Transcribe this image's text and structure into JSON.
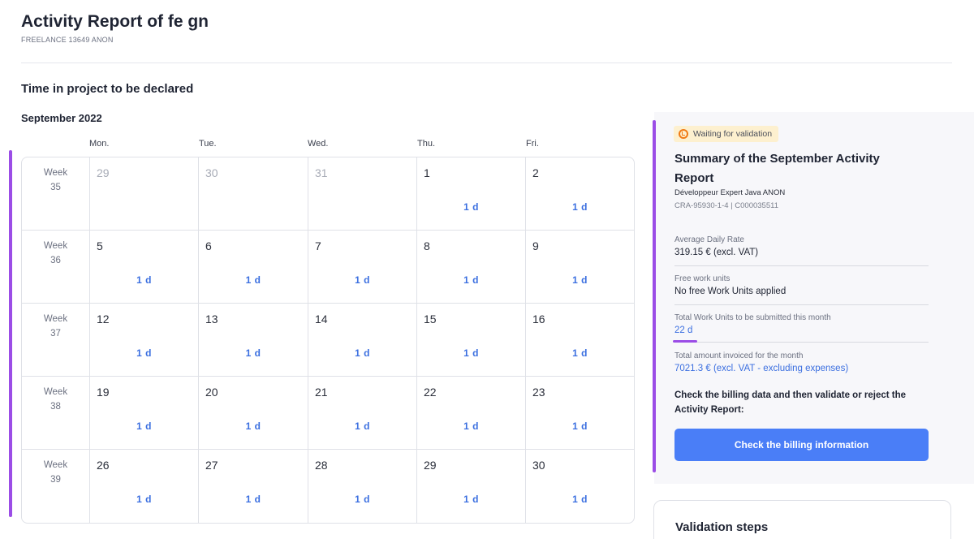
{
  "header": {
    "title": "Activity Report of fe gn",
    "subtitle": "FREELANCE 13649 ANON"
  },
  "section_title": "Time in project to be declared",
  "month_label": "September 2022",
  "calendar": {
    "days": [
      "Mon.",
      "Tue.",
      "Wed.",
      "Thu.",
      "Fri."
    ],
    "weeks": [
      {
        "label": "Week\n35",
        "cells": [
          {
            "day": "29",
            "muted": true,
            "value": ""
          },
          {
            "day": "30",
            "muted": true,
            "value": ""
          },
          {
            "day": "31",
            "muted": true,
            "value": ""
          },
          {
            "day": "1",
            "value": "1 d"
          },
          {
            "day": "2",
            "value": "1 d"
          }
        ]
      },
      {
        "label": "Week\n36",
        "cells": [
          {
            "day": "5",
            "value": "1 d"
          },
          {
            "day": "6",
            "value": "1 d"
          },
          {
            "day": "7",
            "value": "1 d"
          },
          {
            "day": "8",
            "value": "1 d"
          },
          {
            "day": "9",
            "value": "1 d"
          }
        ]
      },
      {
        "label": "Week\n37",
        "cells": [
          {
            "day": "12",
            "value": "1 d"
          },
          {
            "day": "13",
            "value": "1 d"
          },
          {
            "day": "14",
            "value": "1 d"
          },
          {
            "day": "15",
            "value": "1 d"
          },
          {
            "day": "16",
            "value": "1 d"
          }
        ]
      },
      {
        "label": "Week\n38",
        "cells": [
          {
            "day": "19",
            "value": "1 d"
          },
          {
            "day": "20",
            "value": "1 d"
          },
          {
            "day": "21",
            "value": "1 d"
          },
          {
            "day": "22",
            "value": "1 d"
          },
          {
            "day": "23",
            "value": "1 d"
          }
        ]
      },
      {
        "label": "Week\n39",
        "cells": [
          {
            "day": "26",
            "value": "1 d"
          },
          {
            "day": "27",
            "value": "1 d"
          },
          {
            "day": "28",
            "value": "1 d"
          },
          {
            "day": "29",
            "value": "1 d"
          },
          {
            "day": "30",
            "value": "1 d"
          }
        ]
      }
    ]
  },
  "summary": {
    "status": "Waiting for validation",
    "status_icon": "clock-icon",
    "title": "Summary of the September Activity Report",
    "role": "Développeur Expert Java ANON",
    "reference": "CRA-95930-1-4 | C000035511",
    "rate_label": "Average Daily Rate",
    "rate_value": "319.15 € (excl. VAT)",
    "free_units_label": "Free work units",
    "free_units_value": "No free Work Units applied",
    "total_units_label": "Total Work Units to be submitted this month",
    "total_units_value": "22 d",
    "amount_label": "Total amount invoiced for the month",
    "amount_value": "7021.3 € (excl. VAT - excluding expenses)",
    "instruction": "Check the billing data and then validate or reject the Activity Report:",
    "button_label": "Check the billing information"
  },
  "validation": {
    "title": "Validation steps"
  },
  "colors": {
    "accent_purple": "#9b4de6",
    "link_blue": "#3b6fe0",
    "button_blue": "#4a7ef7",
    "badge_bg": "#fdf0cf",
    "badge_icon": "#f07a14"
  }
}
